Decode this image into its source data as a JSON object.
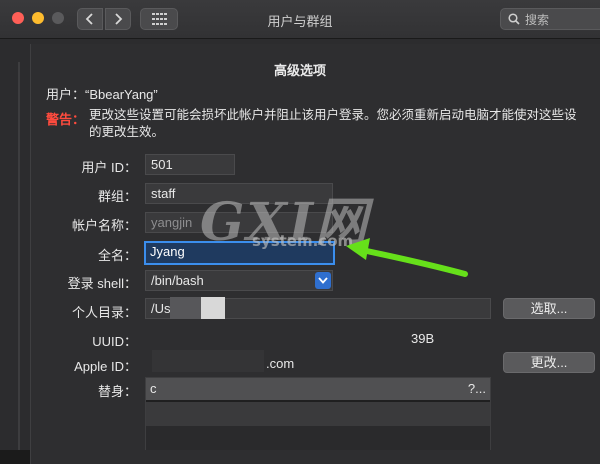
{
  "window": {
    "title": "用户与群组",
    "search_placeholder": "搜索"
  },
  "dialog": {
    "title": "高级选项",
    "user_line": "用户：“BbearYang”",
    "warning_label": "警告：",
    "warning_text_line1": "更改这些设置可能会损坏此帐户并阻止该用户登录。您必须重新启动电脑才能使对这些设",
    "warning_text_line2": "的更改生效。",
    "fields": {
      "user_id_label": "用户 ID：",
      "user_id_value": "501",
      "group_label": "群组：",
      "group_value": "staff",
      "account_name_label": "帐户名称：",
      "account_name_value": "yangjin",
      "full_name_label": "全名：",
      "full_name_value": "Jyang",
      "login_shell_label": "登录 shell：",
      "login_shell_value": "/bin/bash",
      "home_dir_label": "个人目录：",
      "home_dir_value": "/Us",
      "uuid_label": "UUID：",
      "uuid_value_start": "",
      "uuid_value_end": "39B",
      "apple_id_label": "Apple ID：",
      "apple_id_value": ".com",
      "alias_label": "替身：",
      "alias_first_start": "c",
      "alias_first_end": "?..."
    },
    "buttons": {
      "choose": "选取...",
      "change": "更改..."
    }
  },
  "watermark": {
    "main": "GXI网",
    "sub": "system.com"
  },
  "colors": {
    "accent": "#3b8eed",
    "warning": "#ff4b3e",
    "annotation_arrow": "#66e01a"
  }
}
